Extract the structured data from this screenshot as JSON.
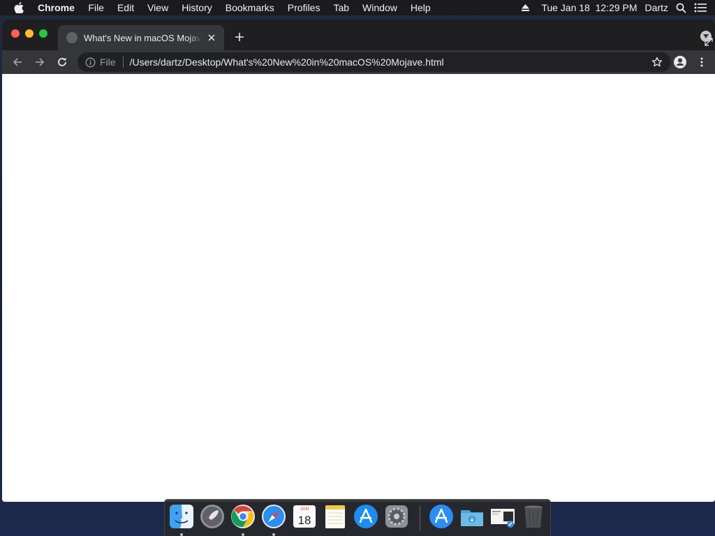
{
  "menubar": {
    "app_name": "Chrome",
    "items": [
      "File",
      "Edit",
      "View",
      "History",
      "Bookmarks",
      "Profiles",
      "Tab",
      "Window",
      "Help"
    ],
    "clock": "Tue Jan 18  12:29 PM",
    "user": "Dartz"
  },
  "browser": {
    "tab": {
      "title": "What's New in macOS Mojave.html"
    },
    "omnibox": {
      "scheme": "File",
      "url": "/Users/dartz/Desktop/What's%20New%20in%20macOS%20Mojave.html"
    }
  },
  "dock": {
    "apps": [
      {
        "name": "Finder",
        "running": true
      },
      {
        "name": "Launchpad",
        "running": false
      },
      {
        "name": "Google Chrome",
        "running": true
      },
      {
        "name": "Safari",
        "running": true
      },
      {
        "name": "Calendar",
        "running": false,
        "month": "JAN",
        "day": "18"
      },
      {
        "name": "Notes",
        "running": false
      },
      {
        "name": "App Store",
        "running": false
      },
      {
        "name": "System Preferences",
        "running": false
      },
      {
        "name": "Applications",
        "running": false
      },
      {
        "name": "Downloads",
        "running": false
      },
      {
        "name": "Recent Screenshots",
        "running": false
      },
      {
        "name": "Trash",
        "running": false
      }
    ]
  },
  "colors": {
    "menubar_bg": "#1b1b1d",
    "tabstrip_bg": "#1f1f21",
    "toolbar_bg": "#35363a",
    "omnibox_bg": "#202124",
    "close": "#fe5f57",
    "minimize": "#febc2e",
    "maximize": "#28c840"
  }
}
